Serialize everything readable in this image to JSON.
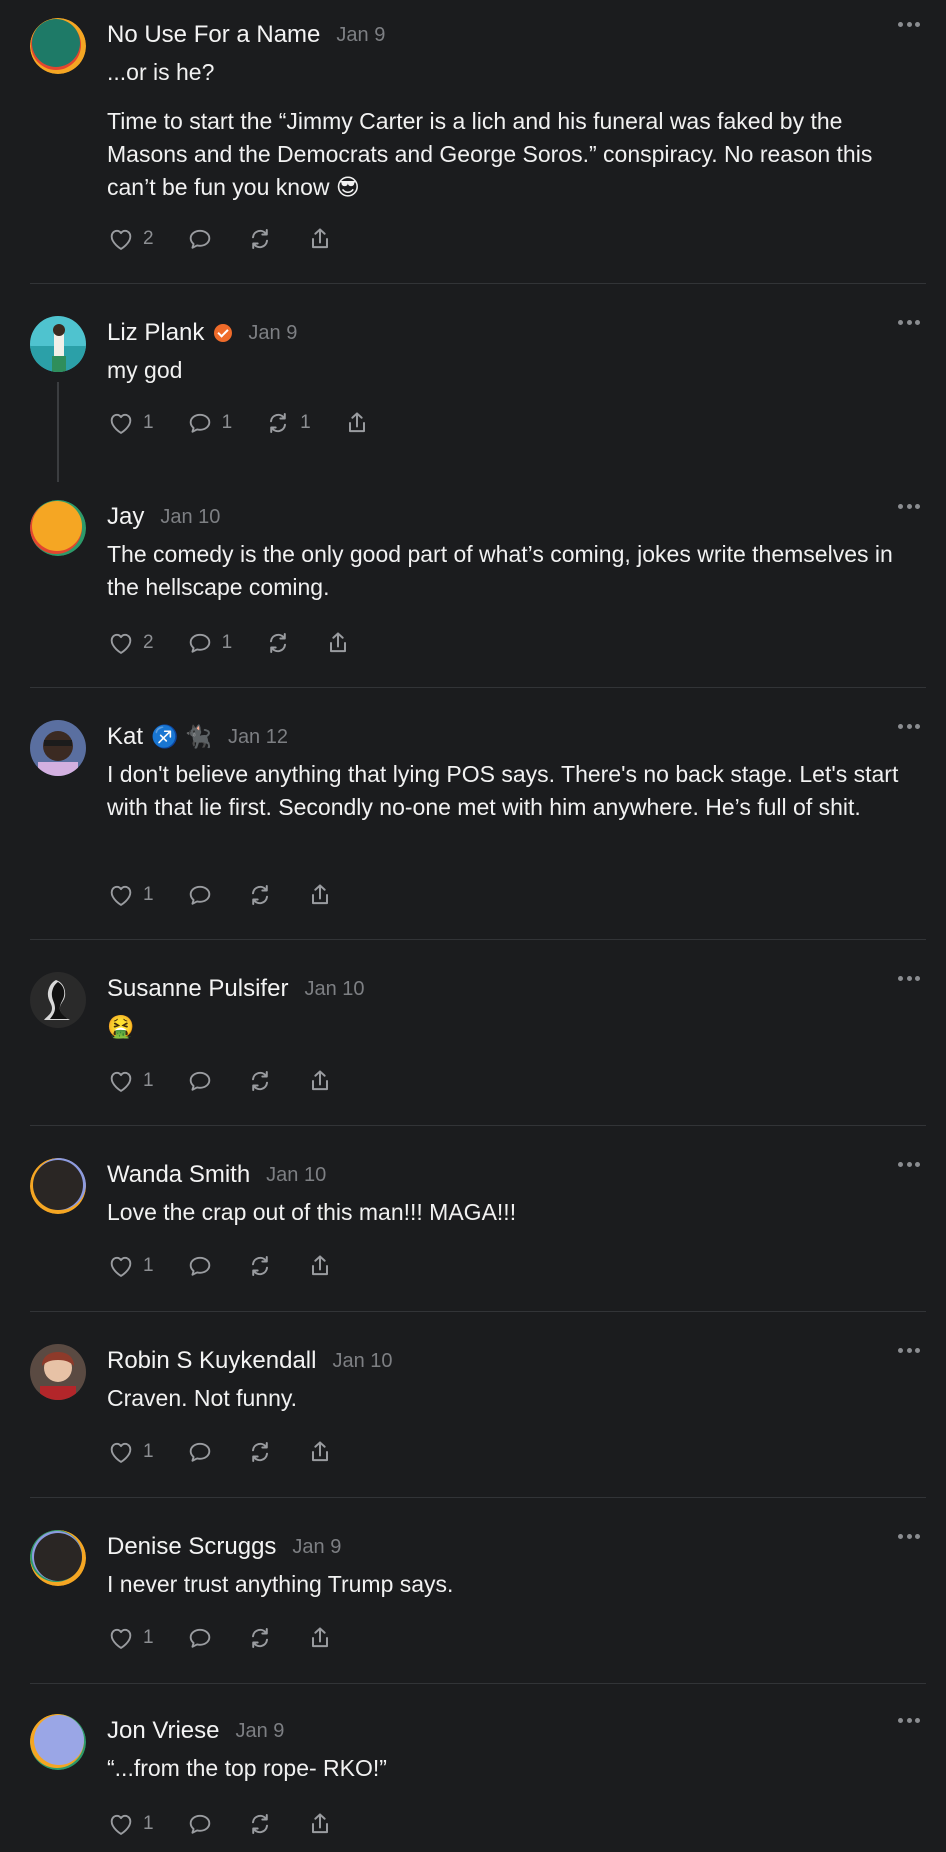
{
  "posts": [
    {
      "name": "No Use For a Name",
      "date": "Jan 9",
      "text1": "...or is he?",
      "text2": "Time to start the “Jimmy Carter is a lich and his funeral was faked by the Masons and the Democrats and George Soros.” conspiracy. No reason this can’t be fun you know 😎",
      "likes": "2",
      "comments": "",
      "reposts": "",
      "avatar_colors": [
        "#1e7a67",
        "#f5a623",
        "#e2462f"
      ]
    },
    {
      "name": "Liz Plank",
      "date": "Jan 9",
      "text1": "my god",
      "likes": "1",
      "comments": "1",
      "reposts": "1",
      "verified": true
    },
    {
      "name": "Jay",
      "date": "Jan 10",
      "text1": "The comedy is the only good part of what’s coming, jokes write themselves in the hellscape coming.",
      "likes": "2",
      "comments": "1",
      "reposts": "",
      "avatar_colors": [
        "#f5a623",
        "#2d9a6a",
        "#e2462f"
      ]
    },
    {
      "name": "Kat",
      "extras": "♐️ 🐈‍⬛",
      "date": "Jan 12",
      "text1": "I don't believe anything that lying POS says. There's no back stage. Let's start with that lie first. Secondly no-one met with him anywhere. He’s full of shit.",
      "likes": "1",
      "comments": "",
      "reposts": ""
    },
    {
      "name": "Susanne Pulsifer",
      "date": "Jan 10",
      "text1": "🤮",
      "likes": "1",
      "comments": "",
      "reposts": ""
    },
    {
      "name": "Wanda Smith",
      "date": "Jan 10",
      "text1": "Love the crap out of this man!!! MAGA!!!",
      "likes": "1",
      "comments": "",
      "reposts": "",
      "avatar_colors": [
        "#2a2624",
        "#f5a623",
        "#8d9be0"
      ]
    },
    {
      "name": "Robin S Kuykendall",
      "date": "Jan 10",
      "text1": "Craven. Not funny.",
      "likes": "1",
      "comments": "",
      "reposts": ""
    },
    {
      "name": "Denise Scruggs",
      "date": "Jan 9",
      "text1": "I never trust anything Trump says.",
      "likes": "1",
      "comments": "",
      "reposts": "",
      "avatar_colors": [
        "#2a2624",
        "#f5a623",
        "#2d9a6a"
      ]
    },
    {
      "name": "Jon Vriese",
      "date": "Jan 9",
      "text1": "“...from the top rope- RKO!”",
      "likes": "1",
      "comments": "",
      "reposts": "",
      "avatar_colors": [
        "#9aa6e6",
        "#f5a623",
        "#2d9a6a"
      ]
    }
  ],
  "icons": [
    "heart-icon",
    "comment-icon",
    "repost-icon",
    "share-icon",
    "more-icon",
    "verified-icon"
  ]
}
